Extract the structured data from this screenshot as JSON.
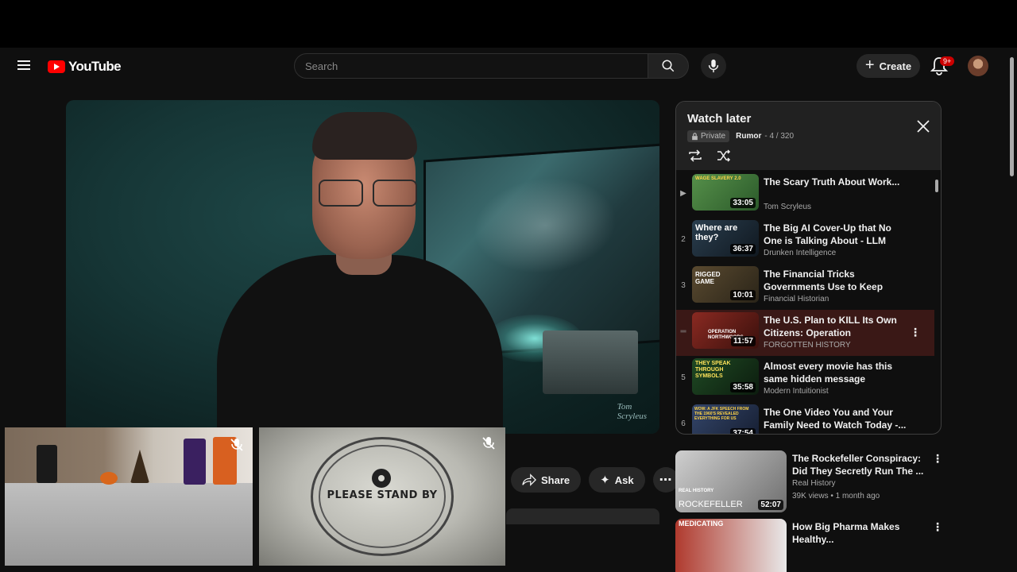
{
  "header": {
    "logo_text": "YouTube",
    "search_placeholder": "Search",
    "create_label": "Create",
    "notification_count": "9+"
  },
  "player": {
    "watermark_line1": "Tom",
    "watermark_line2": "Scryleus"
  },
  "overlays": {
    "stand_by_text": "PLEASE STAND BY"
  },
  "actions": {
    "share_label": "Share",
    "ask_label": "Ask"
  },
  "playlist": {
    "title": "Watch later",
    "privacy": "Private",
    "owner": "Rumor",
    "position": "- 4 / 320",
    "items": [
      {
        "index": "▶",
        "title": "The Scary Truth About Work...",
        "channel": "Tom Scryleus",
        "duration": "33:05",
        "thumb_color": "#3f7a3a",
        "thumb_text": "WAGE SLAVERY 2.0"
      },
      {
        "index": "2",
        "title": "The Big AI Cover-Up that No One is Talking About - LLM Da...",
        "channel": "Drunken Intelligence",
        "duration": "36:37",
        "thumb_color": "#1e2f3d",
        "thumb_text": "Where are they?"
      },
      {
        "index": "3",
        "title": "The Financial Tricks Governments Use to Keep You...",
        "channel": "Financial Historian",
        "duration": "10:01",
        "thumb_color": "#3d3022",
        "thumb_text": "RIGGED GAME"
      },
      {
        "index": "",
        "title": "The U.S. Plan to KILL Its Own Citizens: Operation Northwoods",
        "channel": "FORGOTTEN HISTORY",
        "duration": "11:57",
        "thumb_color": "#5a1c18",
        "thumb_text": "OPERATION NORTHWOODS"
      },
      {
        "index": "5",
        "title": "Almost every movie has this same hidden message",
        "channel": "Modern Intuitionist",
        "duration": "35:58",
        "thumb_color": "#1a3a1a",
        "thumb_text": "THEY SPEAK THROUGH SYMBOLS"
      },
      {
        "index": "6",
        "title": "The One Video You and Your Family Need to Watch Today -...",
        "channel": "",
        "duration": "37:54",
        "thumb_color": "#2a3550",
        "thumb_text": "WOW: A JFK SPEECH FROM THE 1960'S REVEALED EVERYTHING FOR US"
      }
    ]
  },
  "recommendations": [
    {
      "title": "The Rockefeller Conspiracy: Did They Secretly Run The ...",
      "channel": "Real History",
      "stats": "39K views • 1 month ago",
      "duration": "52:07",
      "thumb_text": "ROCKEFELLER",
      "thumb_brand": "REAL HISTORY"
    },
    {
      "title": "How Big Pharma Makes Healthy...",
      "channel": "",
      "stats": "",
      "duration": "",
      "thumb_text": "MEDICATING",
      "thumb_brand": ""
    }
  ]
}
